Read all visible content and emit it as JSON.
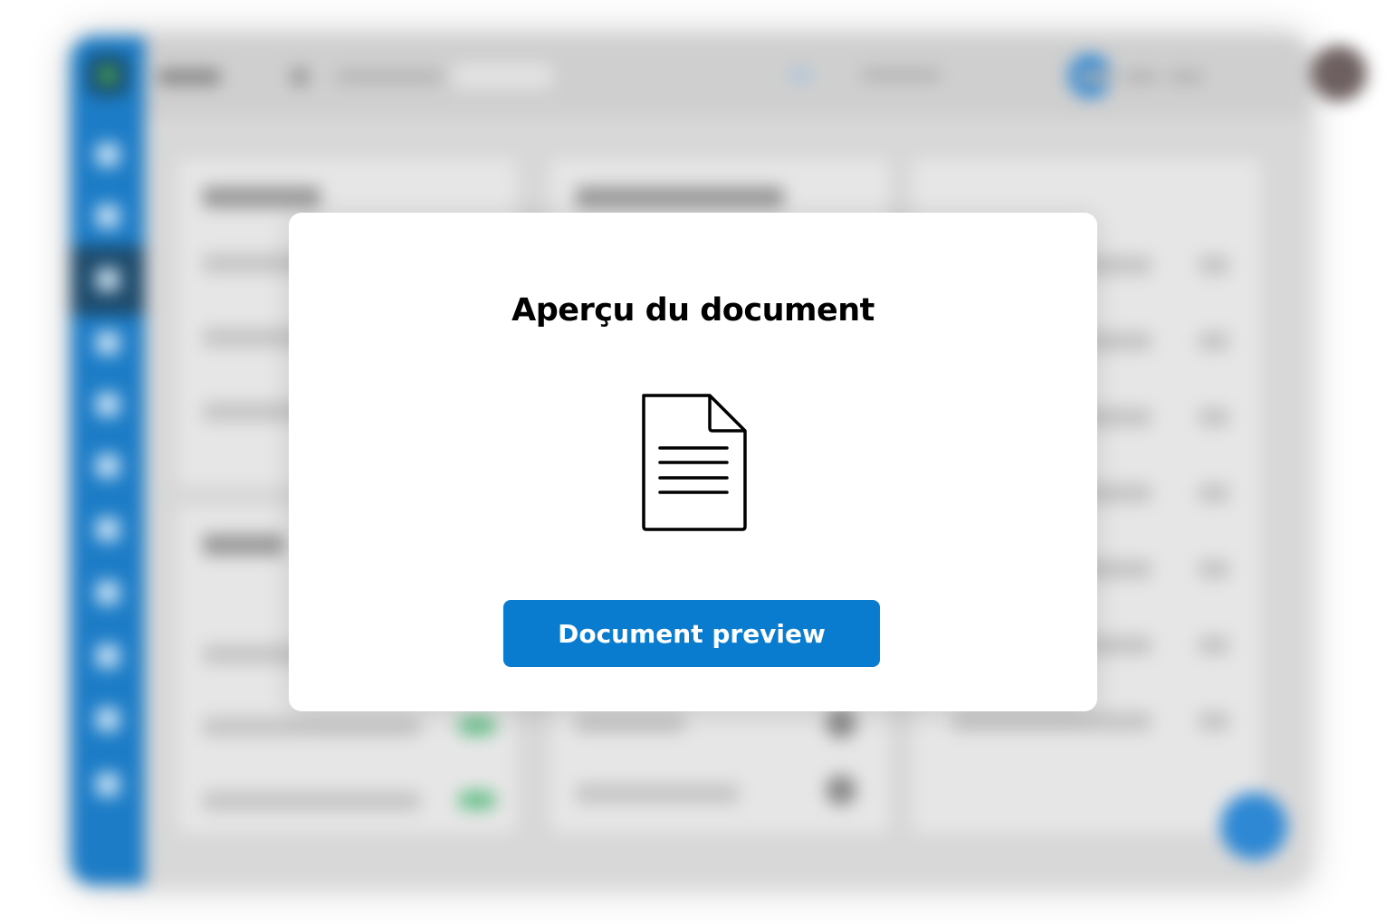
{
  "modal": {
    "title": "Aperçu du document",
    "icon": "document-icon",
    "button_label": "Document preview"
  },
  "colors": {
    "primary_button": "#0a7ccf",
    "sidebar": "#1c7cc6",
    "sidebar_active": "#1d4a6b",
    "status_green": "#67c08a"
  }
}
